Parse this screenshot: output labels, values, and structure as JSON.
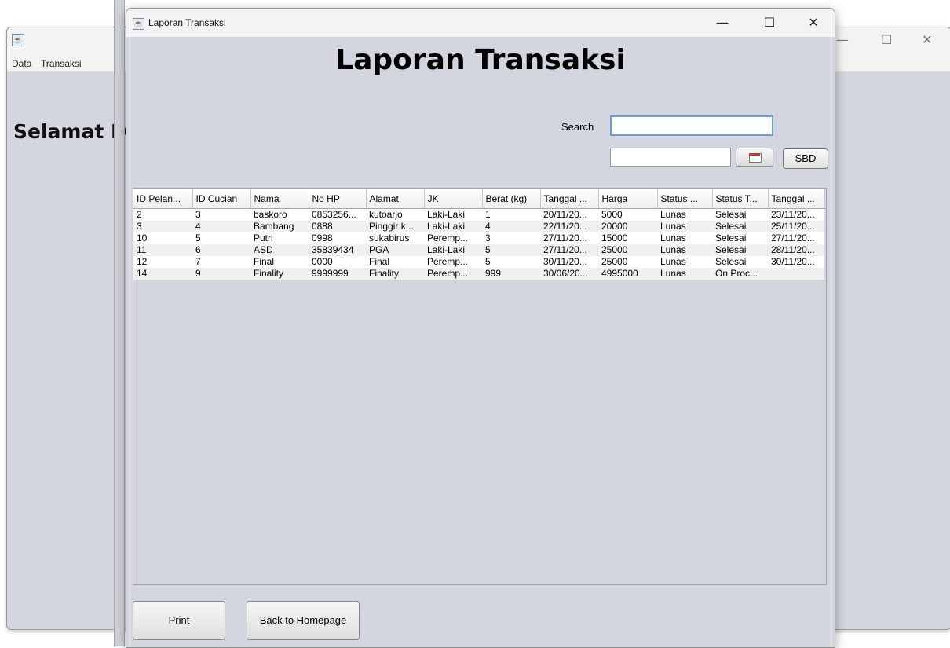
{
  "background_window": {
    "icon": "java-icon",
    "menu": [
      "Data",
      "Transaksi"
    ],
    "welcome_text": "Selamat D"
  },
  "window": {
    "title": "Laporan Transaksi",
    "icon": "java-icon",
    "controls": {
      "minimize": "—",
      "maximize": "☐",
      "close": "✕"
    }
  },
  "page": {
    "heading": "Laporan Transaksi",
    "search_label": "Search",
    "search_value": "",
    "date_value": "",
    "sbd_label": "SBD",
    "print_label": "Print",
    "back_label": "Back to Homepage"
  },
  "table": {
    "columns": [
      "ID Pelan...",
      "ID Cucian",
      "Nama",
      "No HP",
      "Alamat",
      "JK",
      "Berat (kg)",
      "Tanggal ...",
      "Harga",
      "Status ...",
      "Status T...",
      "Tanggal ..."
    ],
    "rows": [
      [
        "2",
        "3",
        "baskoro",
        "0853256...",
        "kutoarjo",
        "Laki-Laki",
        "1",
        "20/11/20...",
        "5000",
        "Lunas",
        "Selesai",
        "23/11/20..."
      ],
      [
        "3",
        "4",
        "Bambang",
        "0888",
        "Pinggir k...",
        "Laki-Laki",
        "4",
        "22/11/20...",
        "20000",
        "Lunas",
        "Selesai",
        "25/11/20..."
      ],
      [
        "10",
        "5",
        "Putri",
        "0998",
        "sukabirus",
        "Peremp...",
        "3",
        "27/11/20...",
        "15000",
        "Lunas",
        "Selesai",
        "27/11/20..."
      ],
      [
        "11",
        "6",
        "ASD",
        "35839434",
        "PGA",
        "Laki-Laki",
        "5",
        "27/11/20...",
        "25000",
        "Lunas",
        "Selesai",
        "28/11/20..."
      ],
      [
        "12",
        "7",
        "Final",
        "0000",
        "Final",
        "Peremp...",
        "5",
        "30/11/20...",
        "25000",
        "Lunas",
        "Selesai",
        "30/11/20..."
      ],
      [
        "14",
        "9",
        "Finality",
        "9999999",
        "Finality",
        "Peremp...",
        "999",
        "30/06/20...",
        "4995000",
        "Lunas",
        "On Proc...",
        ""
      ]
    ]
  }
}
